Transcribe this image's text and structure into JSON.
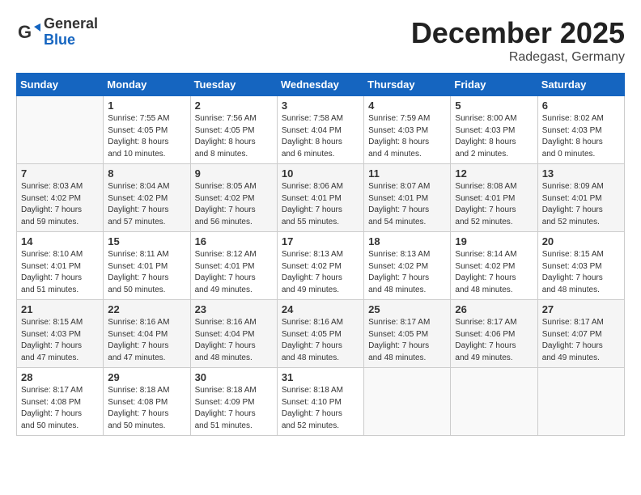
{
  "header": {
    "logo_general": "General",
    "logo_blue": "Blue",
    "month_title": "December 2025",
    "location": "Radegast, Germany"
  },
  "weekdays": [
    "Sunday",
    "Monday",
    "Tuesday",
    "Wednesday",
    "Thursday",
    "Friday",
    "Saturday"
  ],
  "weeks": [
    [
      {
        "day": "",
        "info": ""
      },
      {
        "day": "1",
        "info": "Sunrise: 7:55 AM\nSunset: 4:05 PM\nDaylight: 8 hours\nand 10 minutes."
      },
      {
        "day": "2",
        "info": "Sunrise: 7:56 AM\nSunset: 4:05 PM\nDaylight: 8 hours\nand 8 minutes."
      },
      {
        "day": "3",
        "info": "Sunrise: 7:58 AM\nSunset: 4:04 PM\nDaylight: 8 hours\nand 6 minutes."
      },
      {
        "day": "4",
        "info": "Sunrise: 7:59 AM\nSunset: 4:03 PM\nDaylight: 8 hours\nand 4 minutes."
      },
      {
        "day": "5",
        "info": "Sunrise: 8:00 AM\nSunset: 4:03 PM\nDaylight: 8 hours\nand 2 minutes."
      },
      {
        "day": "6",
        "info": "Sunrise: 8:02 AM\nSunset: 4:03 PM\nDaylight: 8 hours\nand 0 minutes."
      }
    ],
    [
      {
        "day": "7",
        "info": "Sunrise: 8:03 AM\nSunset: 4:02 PM\nDaylight: 7 hours\nand 59 minutes."
      },
      {
        "day": "8",
        "info": "Sunrise: 8:04 AM\nSunset: 4:02 PM\nDaylight: 7 hours\nand 57 minutes."
      },
      {
        "day": "9",
        "info": "Sunrise: 8:05 AM\nSunset: 4:02 PM\nDaylight: 7 hours\nand 56 minutes."
      },
      {
        "day": "10",
        "info": "Sunrise: 8:06 AM\nSunset: 4:01 PM\nDaylight: 7 hours\nand 55 minutes."
      },
      {
        "day": "11",
        "info": "Sunrise: 8:07 AM\nSunset: 4:01 PM\nDaylight: 7 hours\nand 54 minutes."
      },
      {
        "day": "12",
        "info": "Sunrise: 8:08 AM\nSunset: 4:01 PM\nDaylight: 7 hours\nand 52 minutes."
      },
      {
        "day": "13",
        "info": "Sunrise: 8:09 AM\nSunset: 4:01 PM\nDaylight: 7 hours\nand 52 minutes."
      }
    ],
    [
      {
        "day": "14",
        "info": "Sunrise: 8:10 AM\nSunset: 4:01 PM\nDaylight: 7 hours\nand 51 minutes."
      },
      {
        "day": "15",
        "info": "Sunrise: 8:11 AM\nSunset: 4:01 PM\nDaylight: 7 hours\nand 50 minutes."
      },
      {
        "day": "16",
        "info": "Sunrise: 8:12 AM\nSunset: 4:01 PM\nDaylight: 7 hours\nand 49 minutes."
      },
      {
        "day": "17",
        "info": "Sunrise: 8:13 AM\nSunset: 4:02 PM\nDaylight: 7 hours\nand 49 minutes."
      },
      {
        "day": "18",
        "info": "Sunrise: 8:13 AM\nSunset: 4:02 PM\nDaylight: 7 hours\nand 48 minutes."
      },
      {
        "day": "19",
        "info": "Sunrise: 8:14 AM\nSunset: 4:02 PM\nDaylight: 7 hours\nand 48 minutes."
      },
      {
        "day": "20",
        "info": "Sunrise: 8:15 AM\nSunset: 4:03 PM\nDaylight: 7 hours\nand 48 minutes."
      }
    ],
    [
      {
        "day": "21",
        "info": "Sunrise: 8:15 AM\nSunset: 4:03 PM\nDaylight: 7 hours\nand 47 minutes."
      },
      {
        "day": "22",
        "info": "Sunrise: 8:16 AM\nSunset: 4:04 PM\nDaylight: 7 hours\nand 47 minutes."
      },
      {
        "day": "23",
        "info": "Sunrise: 8:16 AM\nSunset: 4:04 PM\nDaylight: 7 hours\nand 48 minutes."
      },
      {
        "day": "24",
        "info": "Sunrise: 8:16 AM\nSunset: 4:05 PM\nDaylight: 7 hours\nand 48 minutes."
      },
      {
        "day": "25",
        "info": "Sunrise: 8:17 AM\nSunset: 4:05 PM\nDaylight: 7 hours\nand 48 minutes."
      },
      {
        "day": "26",
        "info": "Sunrise: 8:17 AM\nSunset: 4:06 PM\nDaylight: 7 hours\nand 49 minutes."
      },
      {
        "day": "27",
        "info": "Sunrise: 8:17 AM\nSunset: 4:07 PM\nDaylight: 7 hours\nand 49 minutes."
      }
    ],
    [
      {
        "day": "28",
        "info": "Sunrise: 8:17 AM\nSunset: 4:08 PM\nDaylight: 7 hours\nand 50 minutes."
      },
      {
        "day": "29",
        "info": "Sunrise: 8:18 AM\nSunset: 4:08 PM\nDaylight: 7 hours\nand 50 minutes."
      },
      {
        "day": "30",
        "info": "Sunrise: 8:18 AM\nSunset: 4:09 PM\nDaylight: 7 hours\nand 51 minutes."
      },
      {
        "day": "31",
        "info": "Sunrise: 8:18 AM\nSunset: 4:10 PM\nDaylight: 7 hours\nand 52 minutes."
      },
      {
        "day": "",
        "info": ""
      },
      {
        "day": "",
        "info": ""
      },
      {
        "day": "",
        "info": ""
      }
    ]
  ]
}
